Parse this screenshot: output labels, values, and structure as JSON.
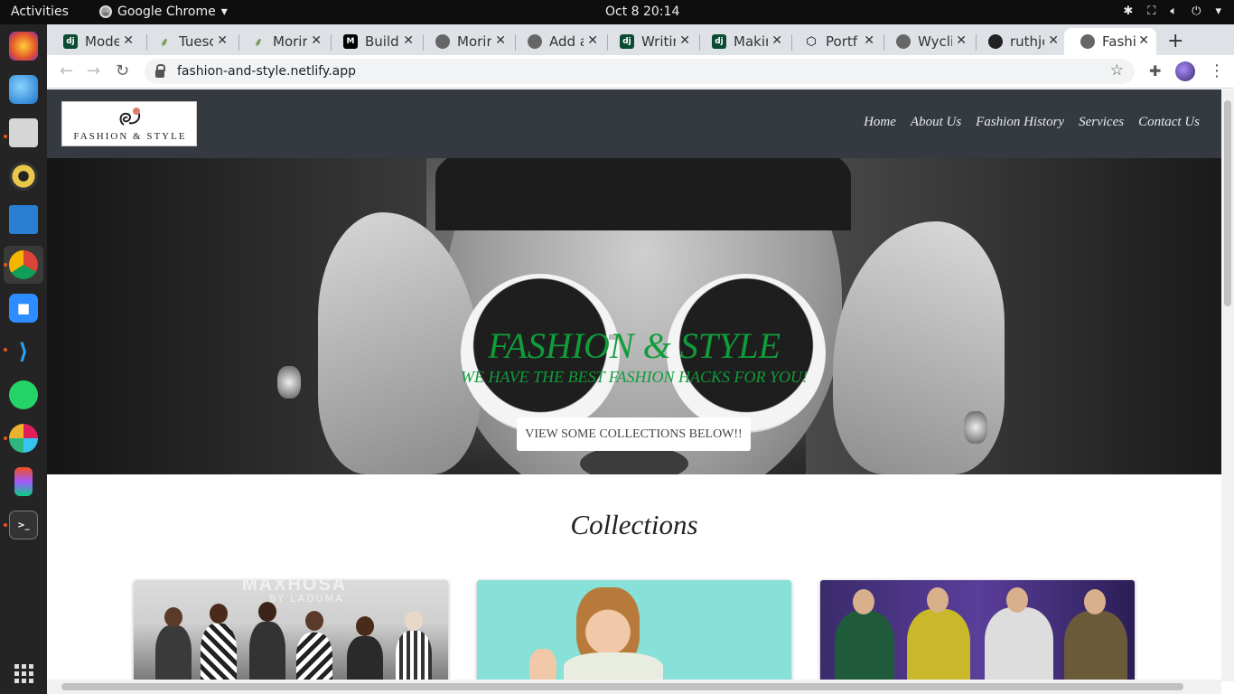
{
  "system": {
    "activities": "Activities",
    "app_name": "Google Chrome",
    "clock": "Oct 8  20:14"
  },
  "dock": [
    "firefox-icon",
    "thunderbird-icon",
    "files-icon",
    "rhythmbox-icon",
    "writer-icon",
    "chrome-icon",
    "zoom-icon",
    "vscode-icon",
    "whatsapp-icon",
    "slack-icon",
    "figma-icon",
    "terminal-icon"
  ],
  "tabs": [
    {
      "title": "Mode",
      "favicon": "dj"
    },
    {
      "title": "Tuesc",
      "favicon": "tree"
    },
    {
      "title": "Morir",
      "favicon": "tree"
    },
    {
      "title": "Build",
      "favicon": "M"
    },
    {
      "title": "Morir",
      "favicon": "globe"
    },
    {
      "title": "Add a",
      "favicon": "globe"
    },
    {
      "title": "Writir",
      "favicon": "dj"
    },
    {
      "title": "Makir",
      "favicon": "dj"
    },
    {
      "title": "Portf",
      "favicon": "codepen"
    },
    {
      "title": "Wycli",
      "favicon": "globe"
    },
    {
      "title": "ruthjc",
      "favicon": "github"
    },
    {
      "title": "Fashi",
      "favicon": "globe"
    }
  ],
  "url": "fashion-and-style.netlify.app",
  "site": {
    "logo_text": "FASHION & STYLE",
    "nav": [
      "Home",
      "About Us",
      "Fashion History",
      "Services",
      "Contact Us"
    ],
    "hero_title": "FASHION & STYLE",
    "hero_subtitle": "WE HAVE THE BEST FASHION HACKS FOR YOU!",
    "hero_button": "VIEW SOME COLLECTIONS BELOW!!",
    "collections_title": "Collections",
    "card1_watermark": "MAXHOSA",
    "card1_watermark_sub": "BY LADUMA"
  },
  "colors": {
    "nav_bg": "#343a40",
    "hero_text": "#0f9d3a",
    "tabstrip": "#dee1e6"
  }
}
